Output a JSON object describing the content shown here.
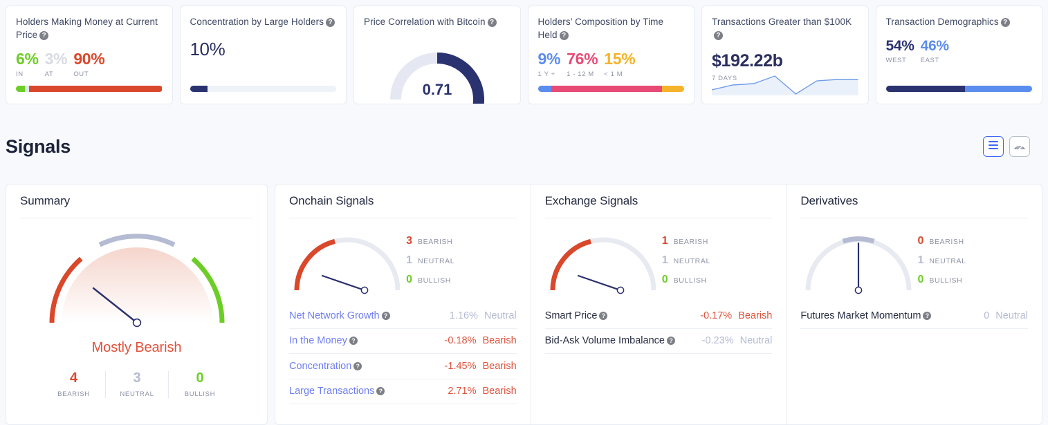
{
  "colors": {
    "bearish": "#d9482b",
    "bearish_text": "#e0513a",
    "neutral": "#b4bbd2",
    "bullish": "#6dcd27",
    "navy": "#2b2f6e",
    "link": "#6f7ff0",
    "accent_blue": "#4066f5",
    "pink": "#e84a76",
    "amber": "#f5b32a",
    "blue": "#5b8def",
    "dark_navy": "#2b3270",
    "muted": "#8e93a6"
  },
  "stat_cards": [
    {
      "id": "holders-making-money",
      "title": "Holders Making Money at Current Price",
      "help": "?",
      "metrics": [
        {
          "value": "6%",
          "label": "IN",
          "color": "#6dcd27"
        },
        {
          "value": "3%",
          "label": "AT",
          "color": "#d7dbe4"
        },
        {
          "value": "90%",
          "label": "OUT",
          "color": "#d9482b"
        }
      ],
      "bar": [
        {
          "pct": 6,
          "color": "#6dcd27"
        },
        {
          "pct": 3,
          "color": "#e0e4ec"
        },
        {
          "pct": 91,
          "color": "#d9482b"
        }
      ]
    },
    {
      "id": "concentration-large-holders",
      "title": "Concentration by Large Holders",
      "help": "?",
      "value": "10%",
      "bar": [
        {
          "pct": 12,
          "color": "#2b3270"
        }
      ]
    },
    {
      "id": "price-correlation-bitcoin",
      "title": "Price Correlation with Bitcoin",
      "help": "?",
      "gauge": {
        "value": "0.71",
        "fraction": 0.71,
        "color": "#2b3270",
        "track": "#e5e8f2"
      }
    },
    {
      "id": "holders-composition-time-held",
      "title": "Holders’ Composition by Time Held",
      "help": "?",
      "metrics": [
        {
          "value": "9%",
          "label": "1 Y +",
          "color": "#5b8def"
        },
        {
          "value": "76%",
          "label": "1 - 12 M",
          "color": "#e84a76"
        },
        {
          "value": "15%",
          "label": "< 1 M",
          "color": "#f5b32a"
        }
      ],
      "bar": [
        {
          "pct": 9,
          "color": "#5b8def"
        },
        {
          "pct": 76,
          "color": "#e84a76"
        },
        {
          "pct": 15,
          "color": "#f5b32a"
        }
      ]
    },
    {
      "id": "transactions-greater-100k",
      "title": "Transactions Greater than $100K",
      "help": "?",
      "value": "$192.22b",
      "sublabel": "7 DAYS",
      "sparkline": {
        "points": [
          0,
          18,
          26,
          30,
          55,
          8,
          44,
          48
        ],
        "line_color": "#6f9ce8",
        "fill_color": "#eaf1fb"
      }
    },
    {
      "id": "transaction-demographics",
      "title": "Transaction Demographics",
      "help": "?",
      "metrics": [
        {
          "value": "54%",
          "label": "WEST",
          "color": "#2b3270"
        },
        {
          "value": "46%",
          "label": "EAST",
          "color": "#5b8def"
        }
      ],
      "bar": [
        {
          "pct": 54,
          "color": "#2b3270"
        },
        {
          "pct": 46,
          "color": "#5b8def"
        }
      ]
    }
  ],
  "signals": {
    "heading": "Signals",
    "view_toggle": [
      {
        "id": "list-view",
        "icon": "list-icon",
        "active": true
      },
      {
        "id": "gauge-view",
        "icon": "gauge-icon",
        "active": false
      }
    ],
    "summary": {
      "title": "Summary",
      "verdict": "Mostly Bearish",
      "verdict_color": "#e0513a",
      "gauge": {
        "needle_angle_deg": 212,
        "segments": [
          "bearish",
          "neutral",
          "bullish"
        ]
      },
      "counts": [
        {
          "num": "4",
          "label": "BEARISH",
          "color": "#d9482b"
        },
        {
          "num": "3",
          "label": "NEUTRAL",
          "color": "#b4bbd2"
        },
        {
          "num": "0",
          "label": "BULLISH",
          "color": "#6dcd27"
        }
      ]
    },
    "groups": [
      {
        "id": "onchain-signals",
        "title": "Onchain Signals",
        "gauge": {
          "fill_fraction": 0.36,
          "needle_angle_deg": 205,
          "fill_color": "#d9482b"
        },
        "counts": [
          {
            "num": "3",
            "label": "BEARISH",
            "color": "#d9482b"
          },
          {
            "num": "1",
            "label": "NEUTRAL",
            "color": "#b4bbd2"
          },
          {
            "num": "0",
            "label": "BULLISH",
            "color": "#6dcd27"
          }
        ],
        "link_style": true,
        "rows": [
          {
            "name": "Net Network Growth",
            "help": "?",
            "pct": "1.16%",
            "state": "Neutral",
            "color": "#b4bbd2"
          },
          {
            "name": "In the Money",
            "help": "?",
            "pct": "-0.18%",
            "state": "Bearish",
            "color": "#e0513a"
          },
          {
            "name": "Concentration",
            "help": "?",
            "pct": "-1.45%",
            "state": "Bearish",
            "color": "#e0513a"
          },
          {
            "name": "Large Transactions",
            "help": "?",
            "pct": "2.71%",
            "state": "Bearish",
            "color": "#e0513a"
          }
        ]
      },
      {
        "id": "exchange-signals",
        "title": "Exchange Signals",
        "gauge": {
          "fill_fraction": 0.36,
          "needle_angle_deg": 205,
          "fill_color": "#d9482b"
        },
        "counts": [
          {
            "num": "1",
            "label": "BEARISH",
            "color": "#d9482b"
          },
          {
            "num": "1",
            "label": "NEUTRAL",
            "color": "#b4bbd2"
          },
          {
            "num": "0",
            "label": "BULLISH",
            "color": "#6dcd27"
          }
        ],
        "link_style": false,
        "rows": [
          {
            "name": "Smart Price",
            "help": "?",
            "pct": "-0.17%",
            "state": "Bearish",
            "color": "#e0513a"
          },
          {
            "name": "Bid-Ask Volume Imbalance",
            "help": "?",
            "pct": "-0.23%",
            "state": "Neutral",
            "color": "#b4bbd2"
          }
        ]
      },
      {
        "id": "derivatives",
        "title": "Derivatives",
        "gauge": {
          "fill_fraction": 0.0,
          "needle_angle_deg": 270,
          "fill_color": "#b4bbd2"
        },
        "counts": [
          {
            "num": "0",
            "label": "BEARISH",
            "color": "#d9482b"
          },
          {
            "num": "1",
            "label": "NEUTRAL",
            "color": "#b4bbd2"
          },
          {
            "num": "0",
            "label": "BULLISH",
            "color": "#6dcd27"
          }
        ],
        "link_style": false,
        "rows": [
          {
            "name": "Futures Market Momentum",
            "help": "?",
            "pct": "0",
            "state": "Neutral",
            "color": "#b4bbd2"
          }
        ]
      }
    ]
  }
}
